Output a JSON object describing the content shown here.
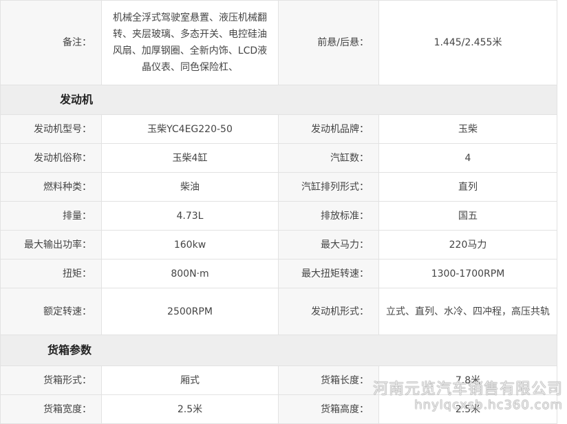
{
  "rows": [
    {
      "label": "备注：",
      "value": "机械全浮式驾驶室悬置、液压机械翻转、夹层玻璃、多态开关、电控硅油风扇、加厚钢圈、全新内饰、LCD液晶仪表、同色保险杠、",
      "label2": "前悬/后悬：",
      "value2": "1.445/2.455米"
    },
    {
      "section": "发动机"
    },
    {
      "label": "发动机型号：",
      "value": "玉柴YC4EG220-50",
      "label2": "发动机品牌：",
      "value2": "玉柴"
    },
    {
      "label": "发动机俗称：",
      "value": "玉柴4缸",
      "label2": "汽缸数：",
      "value2": "4"
    },
    {
      "label": "燃料种类：",
      "value": "柴油",
      "label2": "汽缸排列形式：",
      "value2": "直列"
    },
    {
      "label": "排量：",
      "value": "4.73L",
      "label2": "排放标准：",
      "value2": "国五"
    },
    {
      "label": "最大输出功率：",
      "value": "160kw",
      "label2": "最大马力：",
      "value2": "220马力"
    },
    {
      "label": "扭矩：",
      "value": "800N·m",
      "label2": "最大扭矩转速：",
      "value2": "1300-1700RPM"
    },
    {
      "label": "额定转速：",
      "value": "2500RPM",
      "label2": "发动机形式：",
      "value2": "立式、直列、水冷、四冲程，高压共轨"
    },
    {
      "section": "货箱参数"
    },
    {
      "label": "货箱形式：",
      "value": "厢式",
      "label2": "货箱长度：",
      "value2": "7.8米"
    },
    {
      "label": "货箱宽度：",
      "value": "2.5米",
      "label2": "货箱高度：",
      "value2": "2.5米"
    }
  ],
  "watermark": {
    "line1": "河南元览汽车销售有限公司",
    "line2": "hnylqcxsb.hc360.com"
  }
}
